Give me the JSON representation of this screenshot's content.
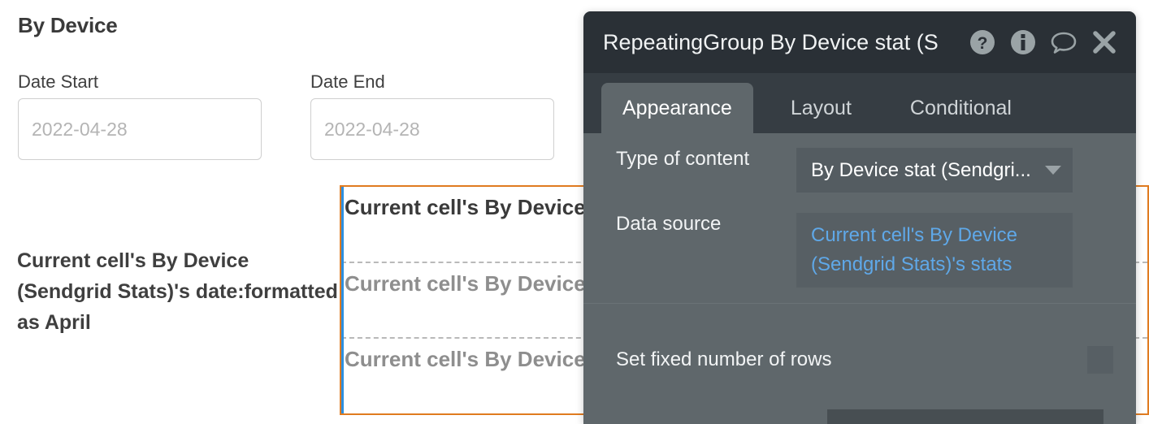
{
  "page": {
    "title": "By Device",
    "fields": [
      {
        "label": "Date Start",
        "placeholder": "2022-04-28",
        "value": "2022-04-28"
      },
      {
        "label": "Date End",
        "placeholder": "2022-04-28",
        "value": "2022-04-28"
      }
    ],
    "left_text": "Current cell's By Device (Sendgrid Stats)'s date:formatted as April"
  },
  "repeating_group": {
    "border_color": "#e07b20",
    "selection_color": "#2d8fe0",
    "cells": [
      {
        "text": "Current cell's By Device (Sendgrid Stats)'s n"
      },
      {
        "text": "Current cell's By Device (Sendgrid Stats)'s n"
      },
      {
        "text": "Current cell's By Device (Sendgrid Stats)'s n"
      }
    ]
  },
  "panel": {
    "title": "RepeatingGroup By Device stat (S",
    "icons": [
      {
        "name": "help-icon",
        "label": "?"
      },
      {
        "name": "info-icon",
        "label": "i"
      },
      {
        "name": "comment-icon",
        "label": "speech-bubble"
      },
      {
        "name": "close-icon",
        "label": "x"
      }
    ],
    "tabs": [
      {
        "label": "Appearance",
        "active": true
      },
      {
        "label": "Layout",
        "active": false
      },
      {
        "label": "Conditional",
        "active": false
      }
    ],
    "properties": {
      "type_of_content": {
        "label": "Type of content",
        "value": "By Device stat (Sendgri..."
      },
      "data_source": {
        "label": "Data source",
        "value": "Current cell's By Device (Sendgrid Stats)'s stats",
        "value_color": "#5fa8e8"
      },
      "set_fixed_rows": {
        "label": "Set fixed number of rows",
        "checked": false
      }
    }
  }
}
